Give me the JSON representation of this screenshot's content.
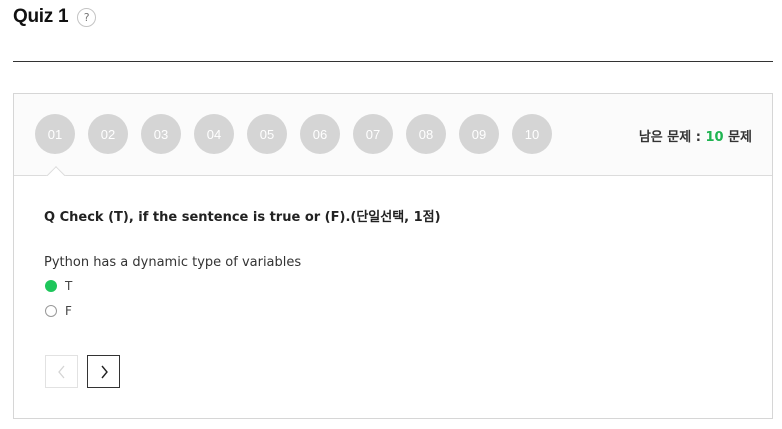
{
  "header": {
    "title": "Quiz 1",
    "help": "?"
  },
  "nav": {
    "questions": [
      "01",
      "02",
      "03",
      "04",
      "05",
      "06",
      "07",
      "08",
      "09",
      "10"
    ],
    "remaining_label": "남은 문제 :",
    "remaining_count": "10",
    "remaining_unit": "문제"
  },
  "question": {
    "title": "Q Check (T), if the sentence is true or (F).(단일선택, 1점)",
    "text": "Python has a dynamic type of variables",
    "options": [
      {
        "label": "T",
        "selected": true
      },
      {
        "label": "F",
        "selected": false
      }
    ]
  },
  "colors": {
    "accent": "#1ec65b",
    "count": "#1fb451",
    "bubble": "#d5d5d5"
  },
  "icons": {
    "prev": "chevron-left-icon",
    "next": "chevron-right-icon"
  }
}
